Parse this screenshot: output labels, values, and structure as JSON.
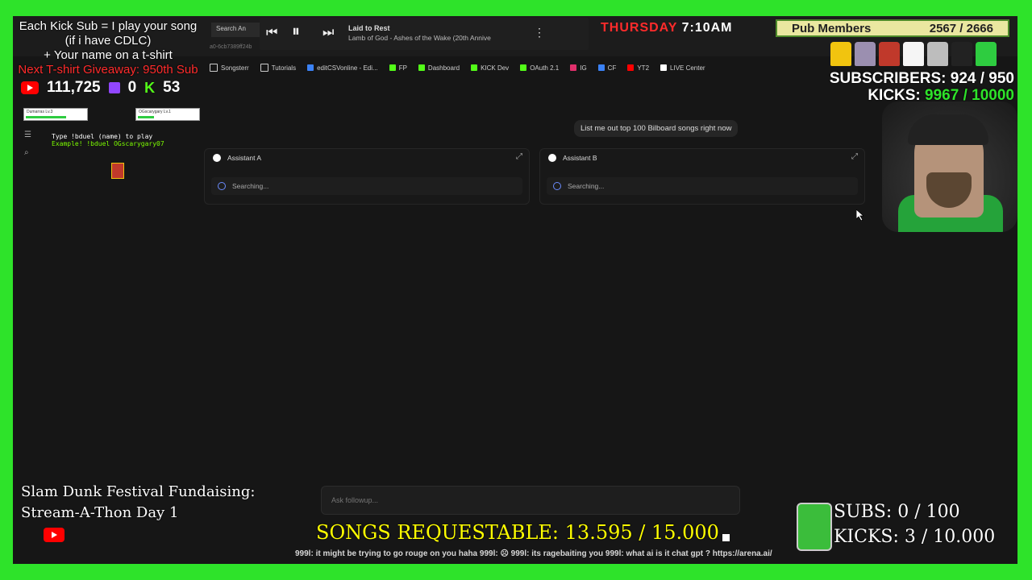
{
  "promo": {
    "line1": "Each Kick Sub = I play your song",
    "line2": "(if i have CDLC)",
    "line3": "+ Your name on a t-shirt",
    "line4": "Next T-shirt Giveaway: 950th Sub"
  },
  "counters": {
    "youtube": "111,725",
    "twitch": "0",
    "kick": "53"
  },
  "widgets": {
    "left_bar": "Dumarras  Lv.3",
    "right_bar": "OGscarygary  Lv.1",
    "duel_line1": "Type !bduel (name) to play",
    "duel_line2": "Example! !bduel OGscarygary07"
  },
  "player": {
    "title": "Laid to Rest",
    "subtitle": "Lamb of God - Ashes of the Wake (20th Annive"
  },
  "browser": {
    "tab": "Search An",
    "url": "a0-6cb7389ff24b",
    "bookmarks": [
      "Songsterr",
      "Tutorials",
      "editCSVonline - Edi...",
      "FP",
      "Dashboard",
      "KICK Dev",
      "OAuth 2.1",
      "IG",
      "CF",
      "YT2",
      "LIVE Center"
    ]
  },
  "clock": {
    "day": "THURSDAY",
    "time": "7:10AM"
  },
  "pub": {
    "label": "Pub Members",
    "count": "2567 / 2666"
  },
  "goals_top": {
    "subs": "SUBSCRIBERS: 924 / 950",
    "kicks_label": "KICKS:",
    "kicks_value": "9967 / 10000"
  },
  "chat": {
    "prompt": "List me out top 100 Bilboard songs right now",
    "assistant_a": "Assistant A",
    "assistant_b": "Assistant B",
    "status_a": "Searching...",
    "status_b": "Searching...",
    "followup_placeholder": "Ask followup..."
  },
  "fundraise": {
    "line1": "Slam Dunk Festival Fundaising:",
    "line2": "Stream-A-Thon Day 1"
  },
  "songs": "SONGS REQUESTABLE: 13.595 / 15.000",
  "goals_bottom": {
    "subs": "SUBS:  0 / 100",
    "kicks": "KICKS: 3 / 10.000"
  },
  "ticker": "999l: it might be trying to go rouge on you haha 999l: ☹ 999l: its ragebaiting you 999l: what ai is it chat gpt ?",
  "ticker_link": "https://arena.ai/",
  "colors": {
    "background": "#2ee32a",
    "panel": "#161616",
    "accent_red": "#ff2b2b",
    "songs_yellow": "#ffff00"
  }
}
